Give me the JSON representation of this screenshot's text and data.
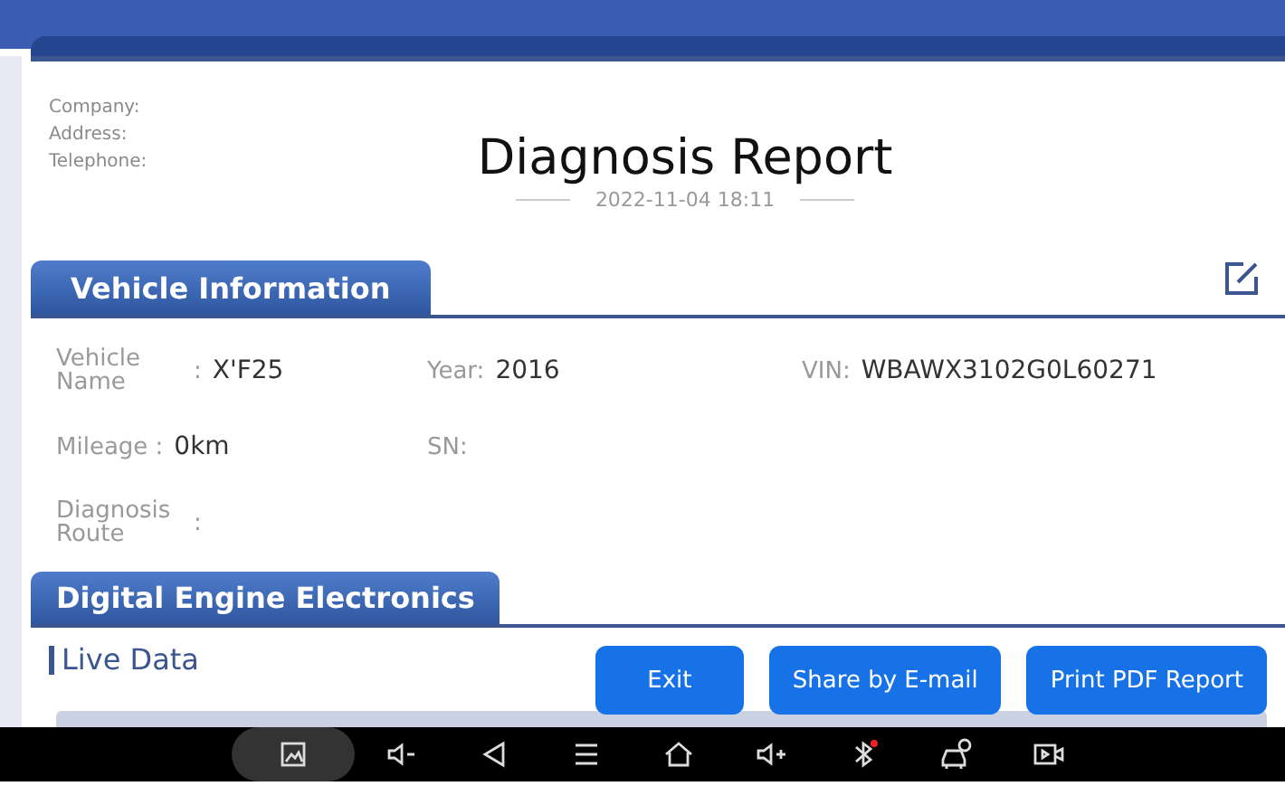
{
  "header": {
    "company_lines": [
      "Company:",
      "Address:",
      "Telephone:"
    ],
    "title": "Diagnosis Report",
    "date": "2022-11-04 18:11"
  },
  "vehicle_section": {
    "title": "Vehicle Information",
    "rows": [
      [
        {
          "label": "Vehicle Name",
          "separator": ":",
          "value": "X'F25"
        },
        {
          "label": "Year:",
          "value": "2016"
        },
        {
          "label": "VIN:",
          "value": "WBAWX3102G0L60271"
        }
      ],
      [
        {
          "label": "Mileage :",
          "value": "0km"
        },
        {
          "label": "SN:"
        }
      ],
      [
        {
          "label": "Diagnosis Route",
          "separator": ":"
        }
      ]
    ]
  },
  "system_section": {
    "title": "Digital Engine Electronics",
    "subtitle": "Live Data"
  },
  "buttons": [
    "Exit",
    "Share by E-mail",
    "Print PDF Report"
  ]
}
